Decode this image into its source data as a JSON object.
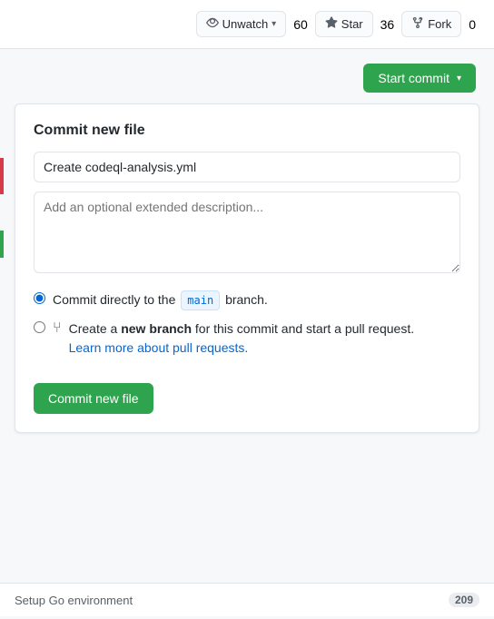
{
  "topbar": {
    "watch_label": "Unwatch",
    "watch_count": "60",
    "star_label": "Star",
    "star_count": "36",
    "fork_label": "Fork",
    "fork_count": "0"
  },
  "start_commit": {
    "button_label": "Start commit",
    "dropdown_arrow": "▾"
  },
  "commit_panel": {
    "title": "Commit new file",
    "title_input_value": "Create codeql-analysis.yml",
    "title_input_placeholder": "Create codeql-analysis.yml",
    "desc_placeholder": "Add an optional extended description...",
    "radio_direct_label_pre": "Commit directly to the",
    "branch_name": "main",
    "radio_direct_label_post": "branch.",
    "radio_pr_label_pre": "Create a",
    "radio_pr_bold": "new branch",
    "radio_pr_label_post": "for this commit and start a pull request.",
    "radio_pr_link": "Learn more about pull requests.",
    "commit_button_label": "Commit new file"
  },
  "bottom": {
    "label": "Setup Go environment",
    "count": "209"
  }
}
